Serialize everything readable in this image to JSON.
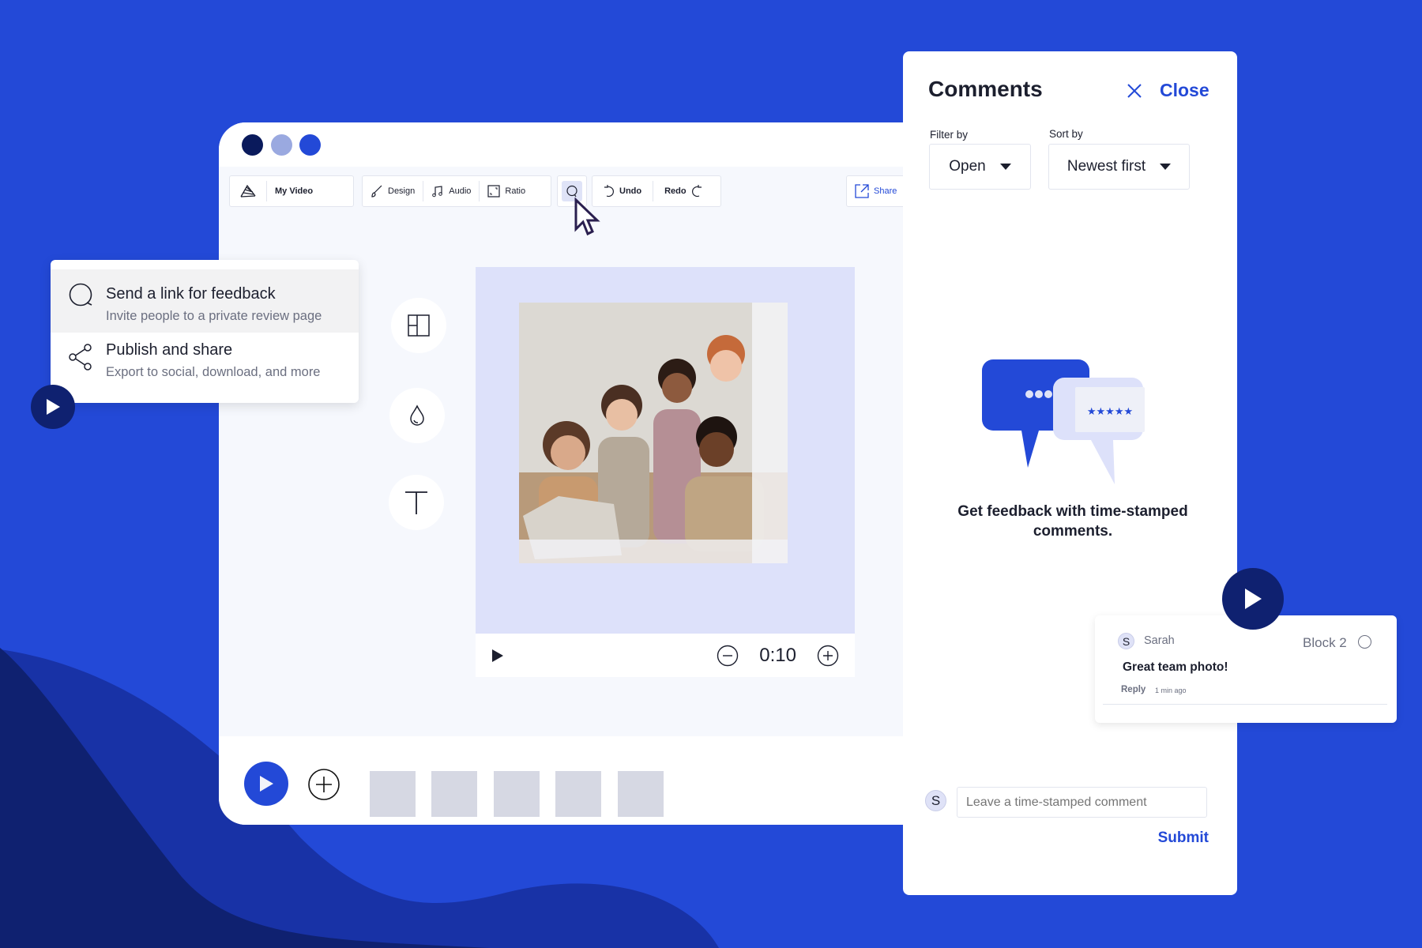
{
  "colors": {
    "background": "#2349d7",
    "accent": "#2349d7",
    "dark_navy": "#0f2170",
    "window_dot_1": "#0a1a5c",
    "window_dot_2": "#9aa9e0",
    "window_dot_3": "#2349d7"
  },
  "editor": {
    "project_name": "My Video",
    "toolbar": {
      "design_label": "Design",
      "audio_label": "Audio",
      "ratio_label": "Ratio",
      "undo_label": "Undo",
      "redo_label": "Redo",
      "share_label": "Share"
    },
    "player": {
      "duration": "0:10"
    },
    "timeline": {
      "block_count": 5
    }
  },
  "share_menu": {
    "items": [
      {
        "title": "Send a link for feedback",
        "subtitle": "Invite people to a private review page",
        "icon": "comment-icon"
      },
      {
        "title": "Publish and share",
        "subtitle": "Export to social, download, and more",
        "icon": "share-icon"
      }
    ]
  },
  "comments_panel": {
    "title": "Comments",
    "close_label": "Close",
    "filter": {
      "label": "Filter by",
      "value": "Open"
    },
    "sort": {
      "label": "Sort by",
      "value": "Newest first"
    },
    "empty_message": "Get feedback with time-stamped comments.",
    "input": {
      "avatar_initial": "S",
      "placeholder": "Leave a time-stamped comment"
    },
    "submit_label": "Submit"
  },
  "comment_card": {
    "avatar_initial": "S",
    "author": "Sarah",
    "block": "Block 2",
    "text": "Great team photo!",
    "reply_label": "Reply",
    "time": "1 min ago"
  }
}
